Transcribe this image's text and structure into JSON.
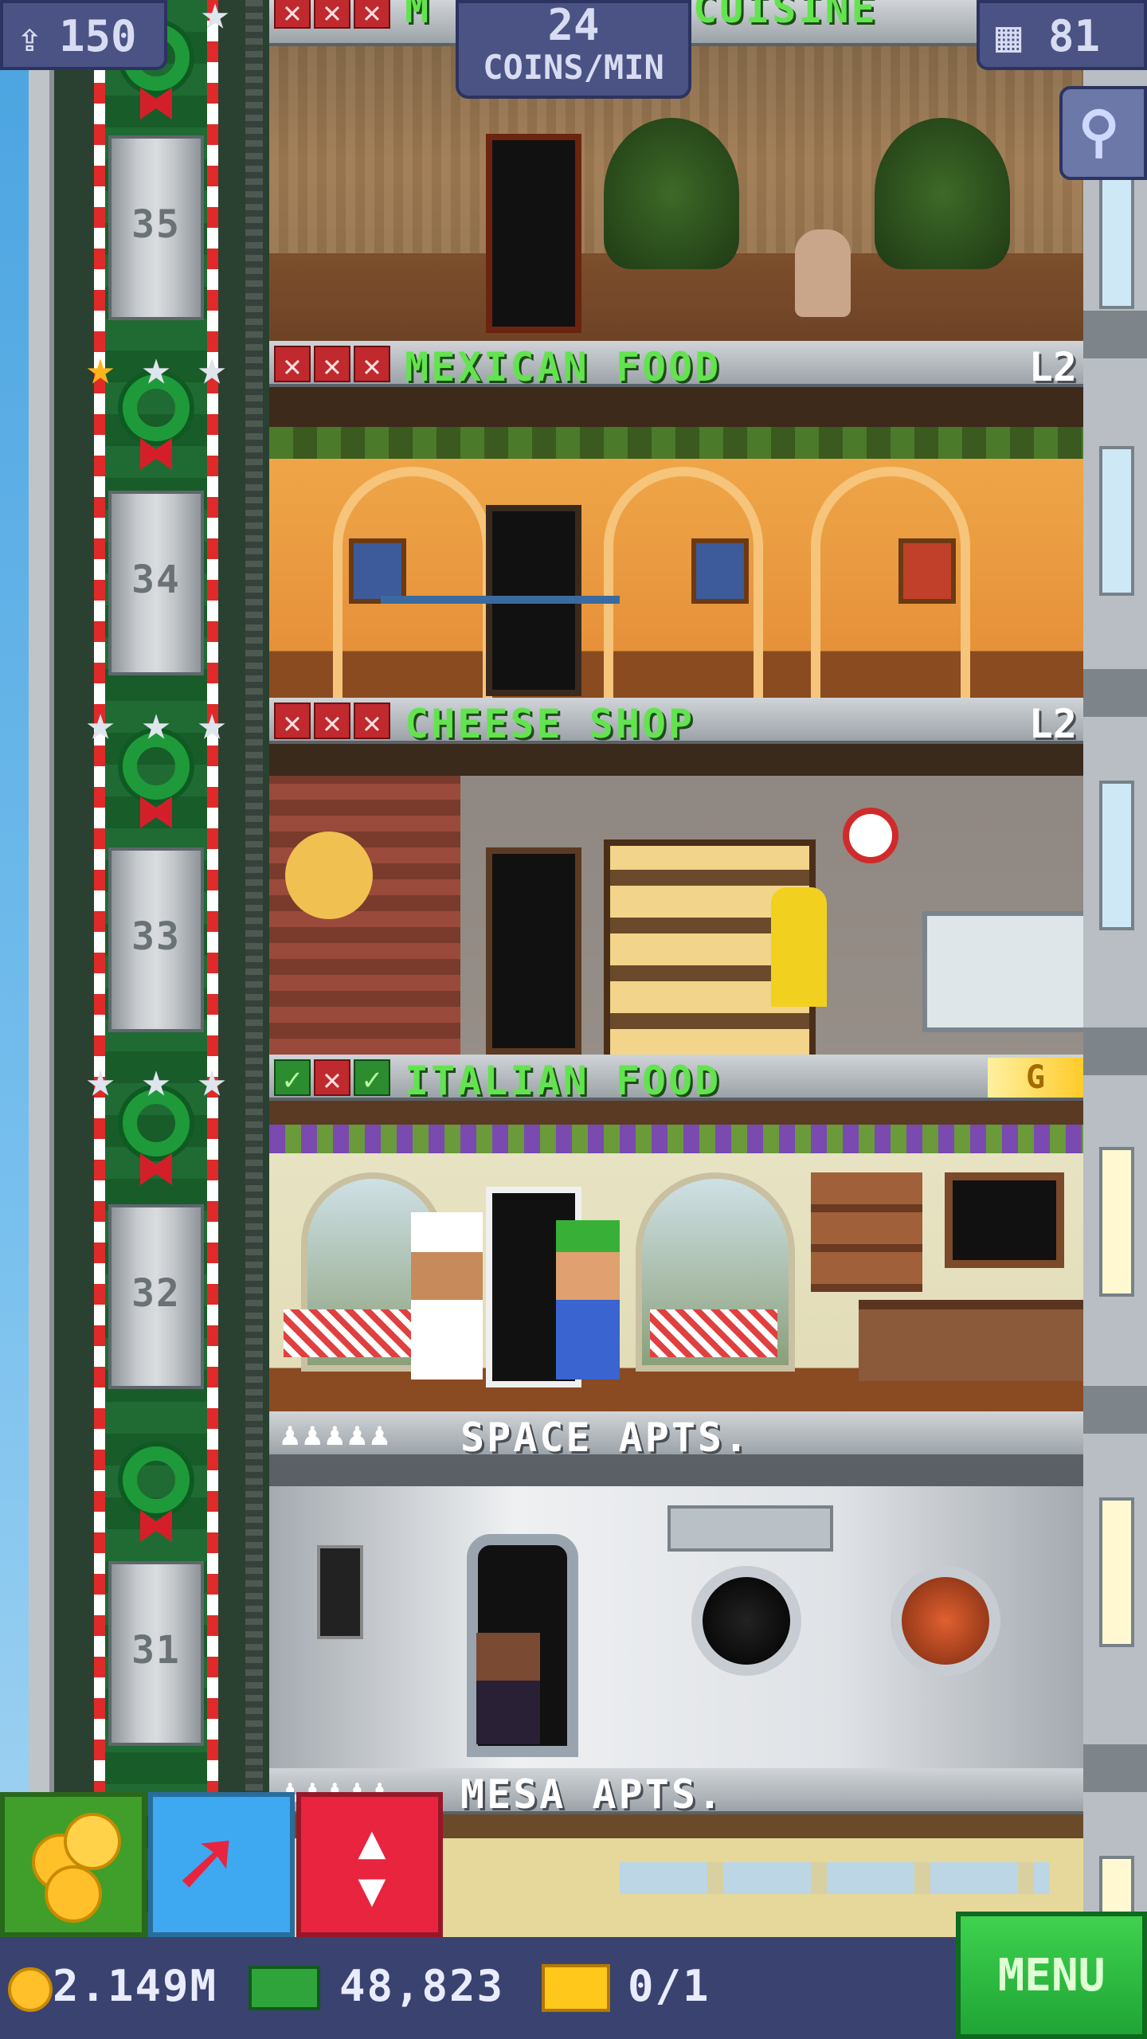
{
  "hud": {
    "population": "150",
    "coins_per_min_value": "24",
    "coins_per_min_unit": "COINS/MIN",
    "floors_count": "81"
  },
  "elevator": {
    "floor_numbers": [
      "35",
      "34",
      "33",
      "32",
      "31"
    ]
  },
  "floors": [
    {
      "name_fragment_left": "M",
      "name_fragment_right": "CUISINE"
    },
    {
      "name": "MEXICAN FOOD",
      "level": "L2",
      "checks": [
        "x",
        "x",
        "x"
      ]
    },
    {
      "name": "CHEESE SHOP",
      "level": "L2",
      "checks": [
        "x",
        "x",
        "x"
      ]
    },
    {
      "name": "ITALIAN FOOD",
      "badge": "G",
      "checks": [
        "✓",
        "x",
        "✓"
      ]
    },
    {
      "name": "SPACE APTS.",
      "dwellers_icons": "♟♟♟♟♟"
    },
    {
      "name": "MESA APTS.",
      "dwellers_icons": "♟♟♟♟♟"
    }
  ],
  "bottom": {
    "coins": "2.149M",
    "bux": "48,823",
    "tickets": "0/1",
    "menu_label": "MENU"
  },
  "icons": {
    "population": "person-up-icon",
    "floors": "building-icon",
    "search": "magnifier-icon",
    "coins": "coins-icon",
    "raise": "arrow-up-right-icon",
    "elevator": "elevator-updown-icon",
    "bux": "bux-bill-icon",
    "ticket": "golden-ticket-icon"
  },
  "colors": {
    "floor_label_green": "#63e34f",
    "hud_blue": "#4a5384",
    "elevator_button_red": "#e8243f",
    "raise_button_blue": "#3ea8f0",
    "coins_button_green": "#3f9f2a",
    "menu_green": "#1fa535"
  }
}
